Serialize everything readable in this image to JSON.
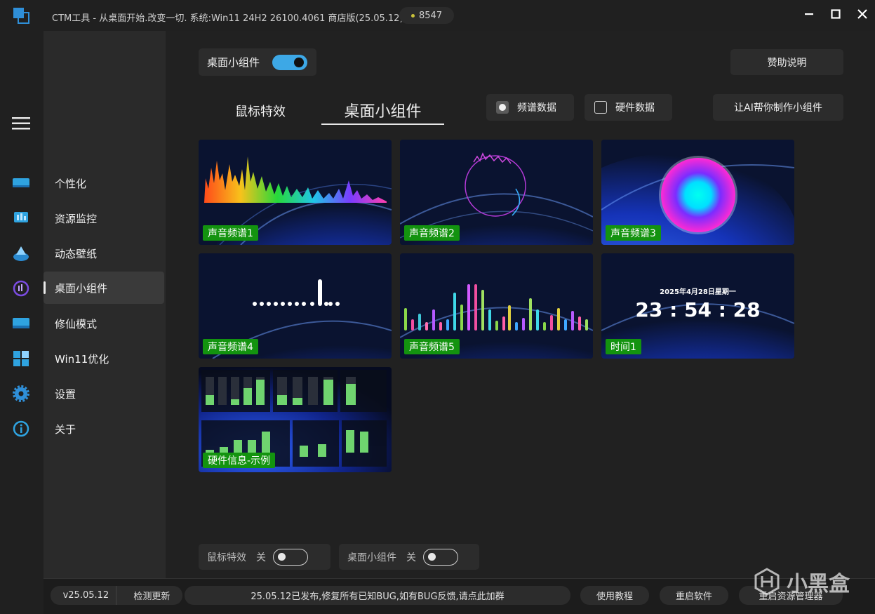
{
  "titlebar": {
    "title": "CTM工具 - 从桌面开始.改变一切. 系统:Win11 24H2 26100.4061 商店版(25.05.12)",
    "coin_count": "8547"
  },
  "nav": {
    "items": [
      {
        "label": "个性化"
      },
      {
        "label": "资源监控"
      },
      {
        "label": "动态壁纸"
      },
      {
        "label": "桌面小组件"
      },
      {
        "label": "修仙模式"
      },
      {
        "label": "Win11优化"
      },
      {
        "label": "设置"
      },
      {
        "label": "关于"
      }
    ],
    "active_index": 3
  },
  "rail_icons": [
    "menu-icon",
    "personalize-icon",
    "monitor-icon",
    "wallpaper-icon",
    "widget-icon",
    "xiuxian-icon",
    "win11-icon",
    "settings-icon",
    "about-icon"
  ],
  "main": {
    "widget_toggle_label": "桌面小组件",
    "widget_toggle_on": true,
    "sponsor_label": "赞助说明",
    "tabs": [
      {
        "label": "鼠标特效",
        "active": false
      },
      {
        "label": "桌面小组件",
        "active": true
      }
    ],
    "filters": [
      {
        "label": "频谱数据",
        "checked": true
      },
      {
        "label": "硬件数据",
        "checked": false
      }
    ],
    "ai_button_label": "让AI帮你制作小组件",
    "cards": [
      {
        "label": "声音频谱1"
      },
      {
        "label": "声音频谱2"
      },
      {
        "label": "声音频谱3"
      },
      {
        "label": "声音频谱4"
      },
      {
        "label": "声音频谱5"
      },
      {
        "label": "时间1",
        "date_text": "2025年4月28日星期一",
        "time_text": "23 : 54 : 28"
      },
      {
        "label": "硬件信息-示例"
      }
    ]
  },
  "bottom": {
    "mouse_effect_label": "鼠标特效",
    "mouse_effect_state": "关",
    "widget_label": "桌面小组件",
    "widget_state": "关"
  },
  "status": {
    "version": "v25.05.12",
    "check_update": "检测更新",
    "notice": "25.05.12已发布,修复所有已知BUG,如有BUG反馈,请点此加群",
    "tutorial": "使用教程",
    "restart_app": "重启软件",
    "restart_explorer": "重启资源管理器"
  },
  "watermark": "小黑盒",
  "colors": {
    "accent": "#3da8e6",
    "label_green": "#13930f",
    "bg": "#202020"
  }
}
